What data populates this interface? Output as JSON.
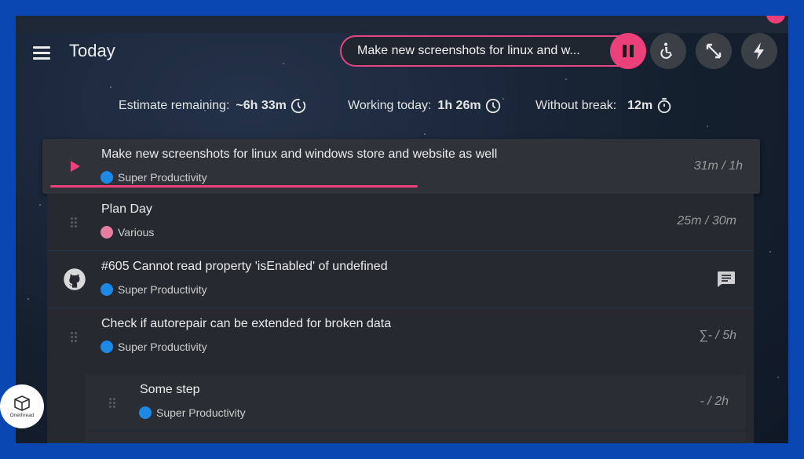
{
  "header": {
    "title": "Today",
    "current_task": "Make new screenshots for linux and w..."
  },
  "stats": {
    "estimate_label": "Estimate remaining:",
    "estimate_value": "~6h 33m",
    "working_label": "Working today:",
    "working_value": "1h 26m",
    "break_label": "Without break:",
    "break_value": "12m"
  },
  "tasks": [
    {
      "title": "Make new screenshots for linux and windows store and website as well",
      "project": "Super Productivity",
      "time": "31m / 1h",
      "active": true,
      "progress": 0.52
    },
    {
      "title": "Plan Day",
      "project": "Various",
      "time": "25m / 30m"
    },
    {
      "title": "#605 Cannot read property 'isEnabled' of undefined",
      "project": "Super Productivity",
      "time": ""
    },
    {
      "title": "Check if autorepair can be extended for broken data",
      "project": "Super Productivity",
      "time": "∑- / 5h"
    }
  ],
  "subtasks": [
    {
      "title": "Some step",
      "project": "Super Productivity",
      "time": "- / 2h"
    }
  ],
  "badge": {
    "label": "Onethread"
  },
  "colors": {
    "accent": "#ec407a",
    "frame": "#0a47b3",
    "project_sp": "#1e88e5",
    "project_various": "#e57fa0"
  }
}
